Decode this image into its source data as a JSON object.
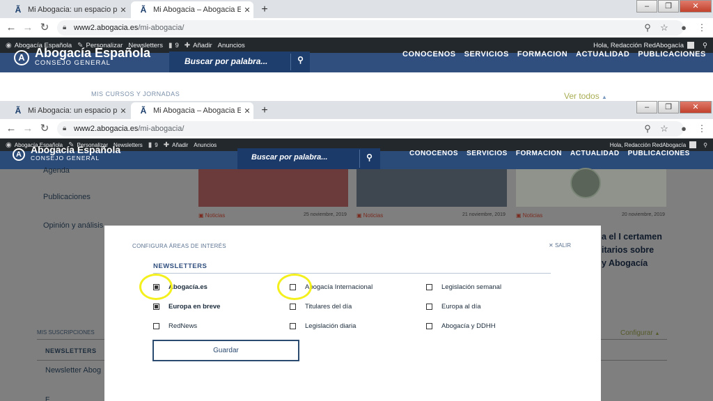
{
  "browser": {
    "tabs": [
      {
        "favicon": "Ã",
        "title": "Mi Abogacia: un espacio persona",
        "active": false
      },
      {
        "favicon": "Ã",
        "title": "Mi Abogacia – Abogacia Españo",
        "active": true
      }
    ],
    "newtab": "+",
    "url_domain": "www2.abogacia.es",
    "url_path": "/mi-abogacia/",
    "window_buttons": {
      "minimize": "‒",
      "maximize": "❐",
      "close": "✕"
    }
  },
  "adminbar": {
    "items": [
      {
        "icon": "wp-logo-icon",
        "label": "Abogacía Española"
      },
      {
        "icon": "brush-icon",
        "label": "Personalizar"
      },
      {
        "icon": "",
        "label": "Newsletters"
      },
      {
        "icon": "comment-icon",
        "label": "9"
      },
      {
        "icon": "plus-icon",
        "label": "Añadir"
      },
      {
        "icon": "",
        "label": "Anuncios"
      }
    ],
    "greeting_top": "Hola, Redacción RedAbogacía",
    "greeting_bottom": "Hola, Redacción RedAbogacía"
  },
  "site": {
    "brand_name": "Abogacía Española",
    "brand_sub": "CONSEJO GENERAL",
    "search_placeholder": "Buscar por palabra...",
    "nav": [
      "CONOCENOS",
      "SERVICIOS",
      "FORMACION",
      "ACTUALIDAD",
      "PUBLICACIONES"
    ]
  },
  "upper_section": {
    "courses_label": "MIS CURSOS Y JORNADAS",
    "ver_todos": "Ver todos"
  },
  "bg_page": {
    "sidebar_menu": [
      "Agenda",
      "Publicaciones",
      "Opinión y análisis"
    ],
    "cards": [
      {
        "tag": "Noticias",
        "date": "25 noviembre, 2019"
      },
      {
        "tag": "Noticias",
        "date": "21 noviembre, 2019"
      },
      {
        "tag": "Noticias",
        "date": "20 noviembre, 2019"
      }
    ],
    "headline_lines": [
      "a el I certamen",
      "itarios sobre",
      "y Abogacía"
    ],
    "subs_label": "MIS SUSCRIPCIONES",
    "configurar": "Configurar",
    "newsletters_label": "NEWSLETTERS",
    "newsletter_item": "Newsletter Abog",
    "bottom_partial": "E"
  },
  "modal": {
    "title": "CONFIGURA ÁREAS DE INTERÉS",
    "close_label": "SALIR",
    "section": "NEWSLETTERS",
    "options": [
      {
        "label": "Abogacía.es",
        "checked": true
      },
      {
        "label": "Abogacía Internacional",
        "checked": false
      },
      {
        "label": "Legislación semanal",
        "checked": false
      },
      {
        "label": "Europa en breve",
        "checked": true
      },
      {
        "label": "Titulares del día",
        "checked": false
      },
      {
        "label": "Europa al día",
        "checked": false
      },
      {
        "label": "RedNews",
        "checked": false
      },
      {
        "label": "Legislación diaria",
        "checked": false
      },
      {
        "label": "Abogacía y DDHH",
        "checked": false
      }
    ],
    "save_label": "Guardar"
  },
  "colors": {
    "header_blue": "#304f7e",
    "search_blue": "#1e3e6e",
    "accent_olive": "#a9ad52",
    "highlight_yellow": "#f4f01e",
    "overlay_grey": "#7f7f7f"
  }
}
